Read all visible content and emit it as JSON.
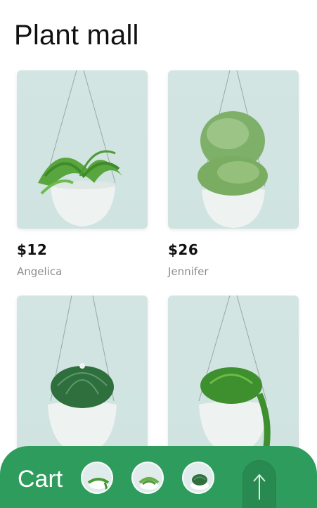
{
  "header": {
    "title": "Plant mall"
  },
  "products": [
    {
      "price": "$12",
      "name": "Angelica"
    },
    {
      "price": "$26",
      "name": "Jennifer"
    },
    {
      "price": "",
      "name": ""
    },
    {
      "price": "",
      "name": ""
    }
  ],
  "cart": {
    "label": "Cart"
  },
  "colors": {
    "accent": "#2e9c5c",
    "accent_dark": "#288a50",
    "card_bg": "#d3e5e3"
  },
  "icons": {
    "scroll_top": "arrow-up-icon"
  }
}
